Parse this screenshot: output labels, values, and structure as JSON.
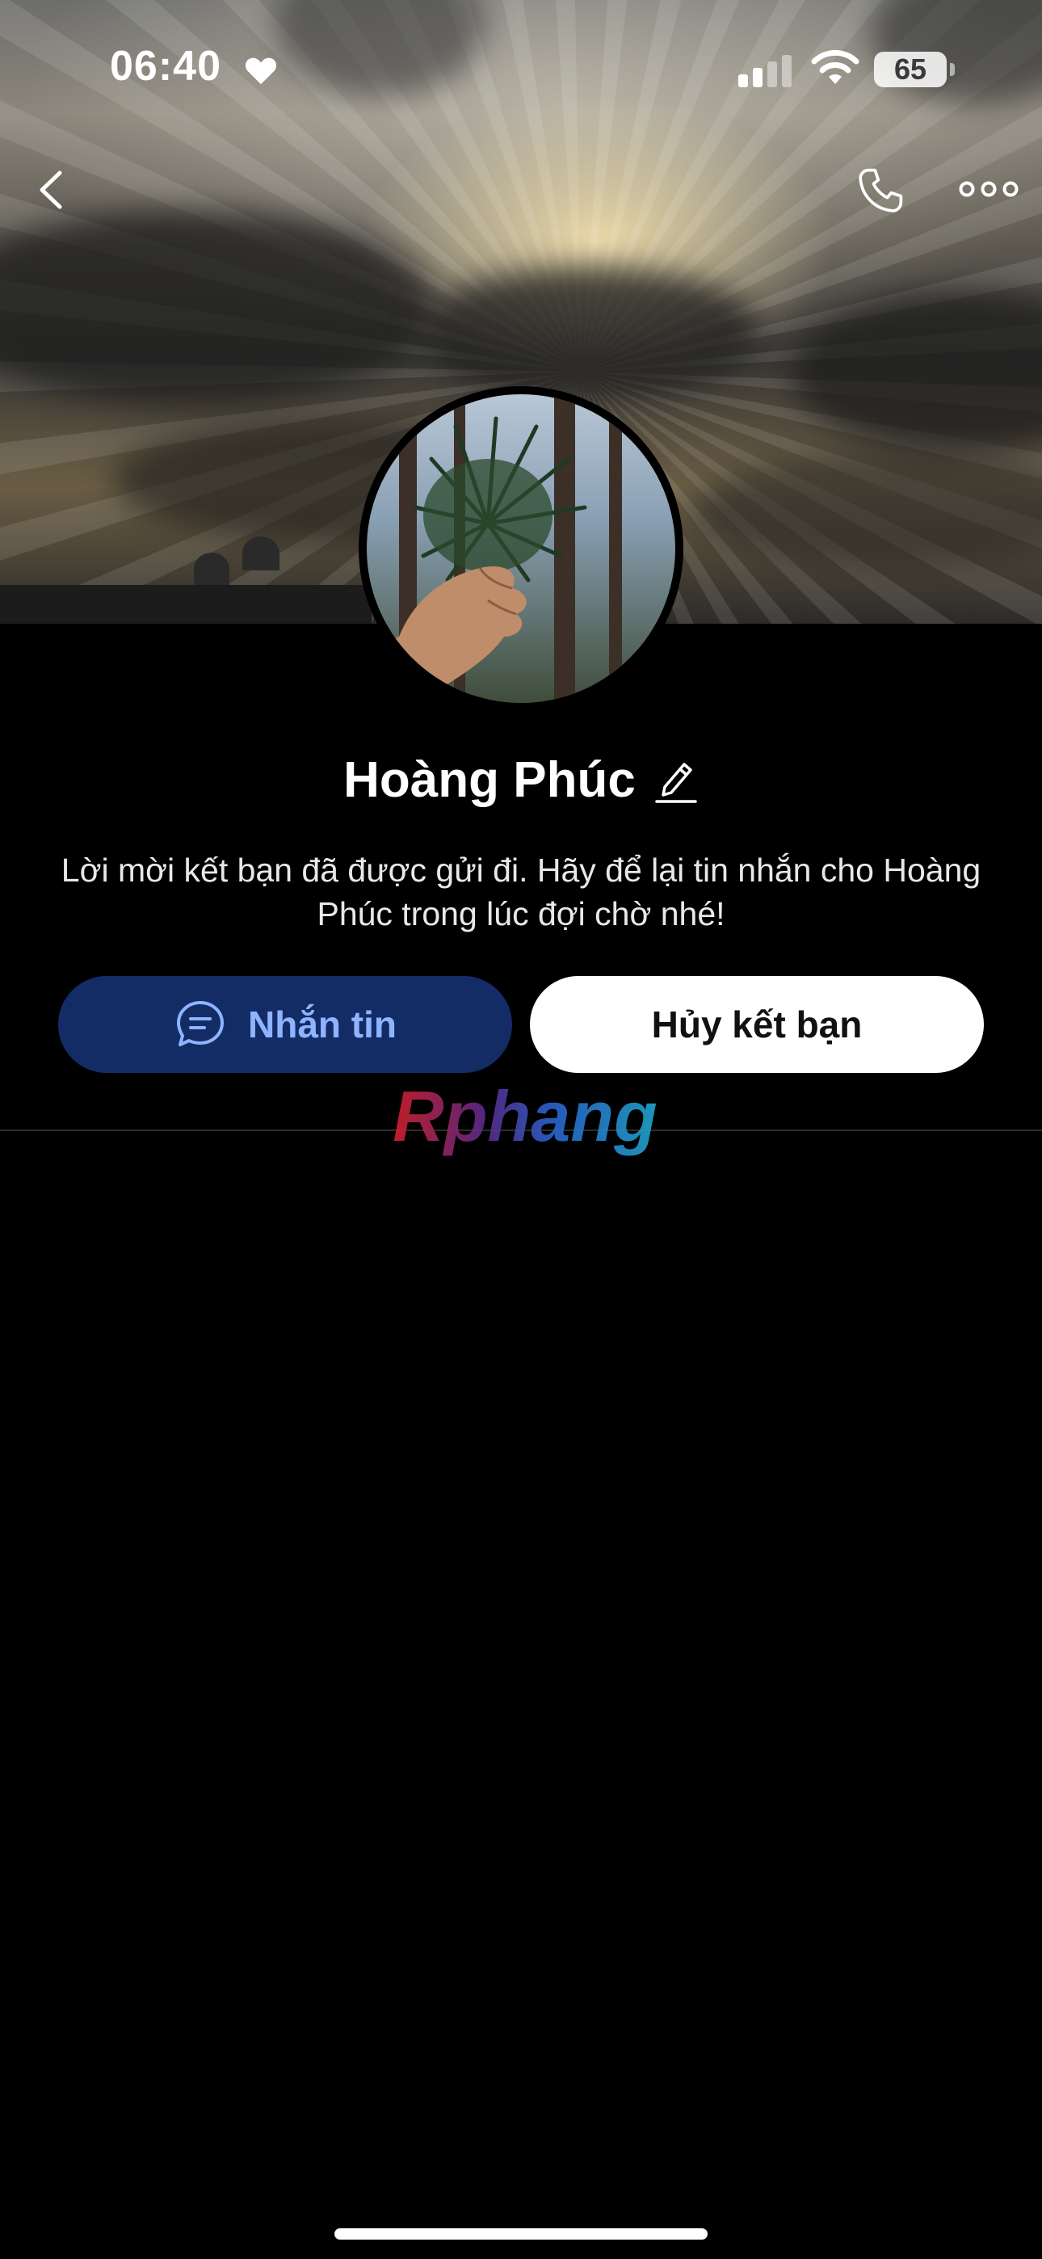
{
  "status_bar": {
    "time": "06:40",
    "battery": "65",
    "icons": [
      "heart-icon",
      "signal-icon",
      "wifi-icon",
      "battery-icon"
    ]
  },
  "nav": {
    "icons": [
      "back-chevron-icon",
      "phone-icon",
      "more-horizontal-icon"
    ]
  },
  "profile": {
    "name": "Hoàng Phúc",
    "invite_message": "Lời mời kết bạn đã được gửi đi. Hãy để lại tin nhắn cho Hoàng Phúc trong lúc đợi chờ nhé!"
  },
  "actions": {
    "message_label": "Nhắn tin",
    "unfriend_label": "Hủy kết bạn"
  },
  "watermark": {
    "text": "Rphang"
  },
  "colors": {
    "background": "#000000",
    "message_button_bg": "#142c66",
    "message_button_text": "#8fb4ff",
    "unfriend_button_bg": "#ffffff",
    "unfriend_button_text": "#111111"
  }
}
